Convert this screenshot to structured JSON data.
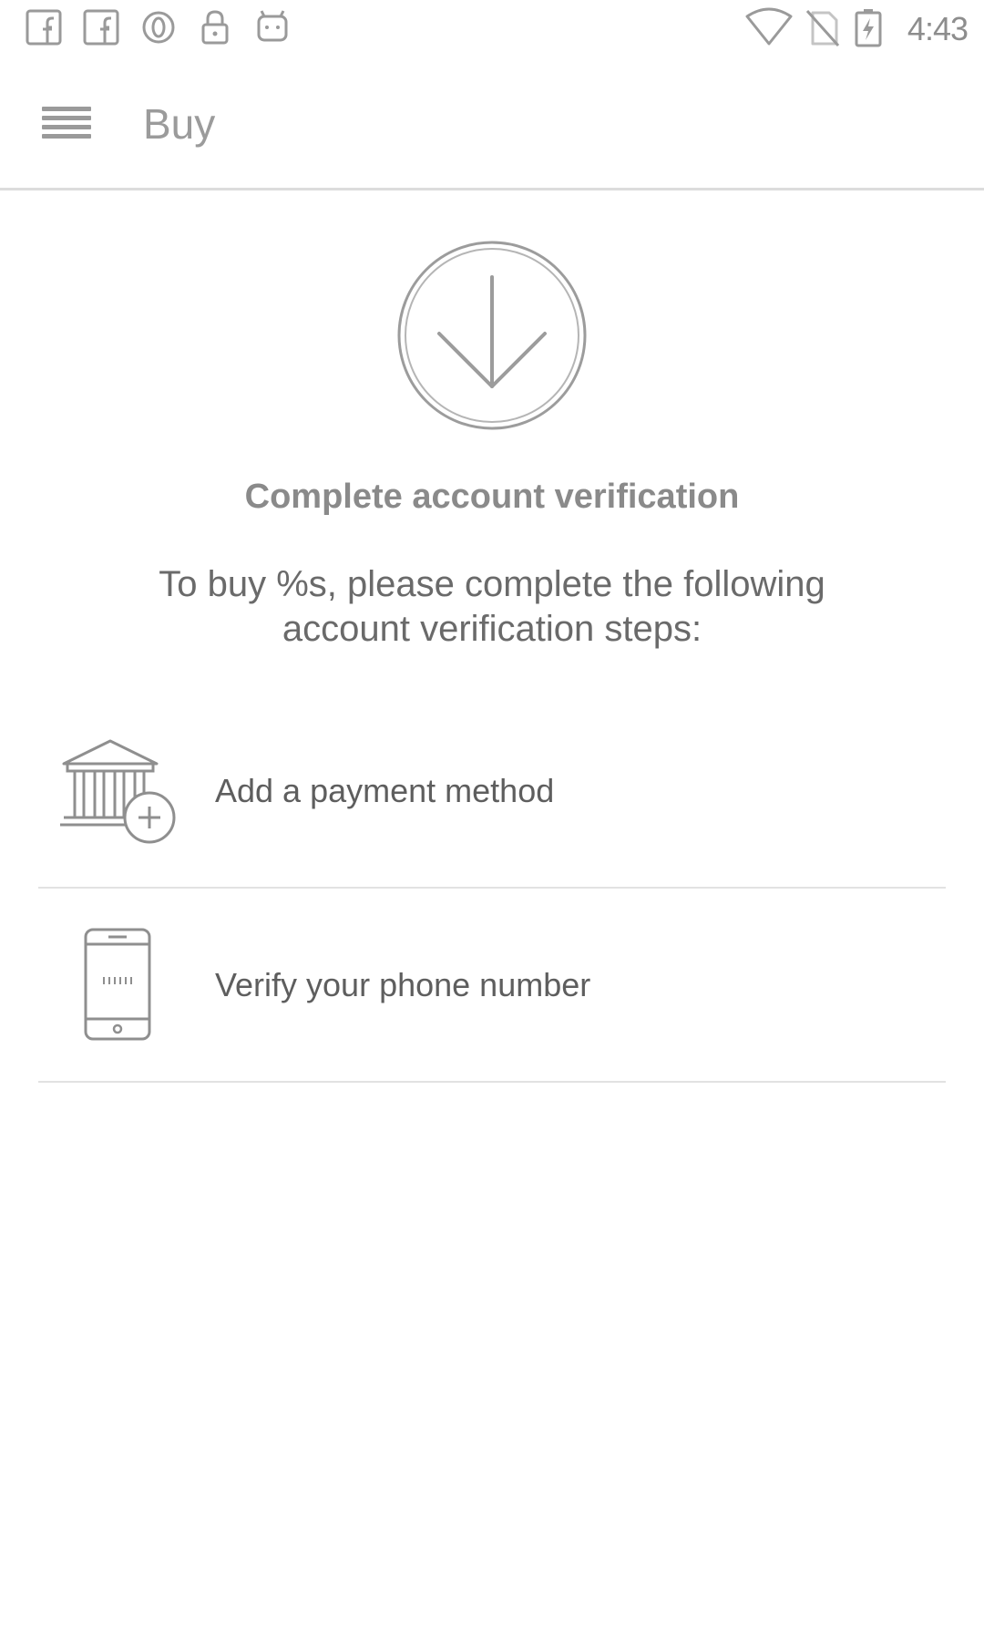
{
  "status_bar": {
    "icons": [
      "facebook-icon",
      "facebook-icon",
      "opera-icon",
      "lock-icon",
      "android-icon"
    ],
    "right_icons": [
      "wifi-icon",
      "no-sim-icon",
      "battery-charging-icon"
    ],
    "time": "4:43"
  },
  "app_bar": {
    "menu_icon": "menu-icon",
    "title": "Buy"
  },
  "content": {
    "hero_icon": "download-arrow-circle-icon",
    "heading": "Complete account verification",
    "subtext": "To buy %s, please complete the following account verification steps:",
    "steps": [
      {
        "icon": "bank-add-icon",
        "label": "Add a payment method"
      },
      {
        "icon": "phone-icon",
        "label": "Verify your phone number"
      }
    ]
  },
  "colors": {
    "background": "#ffffff",
    "icon_stroke": "#8f8f8f",
    "divider": "#e2e2e2"
  }
}
